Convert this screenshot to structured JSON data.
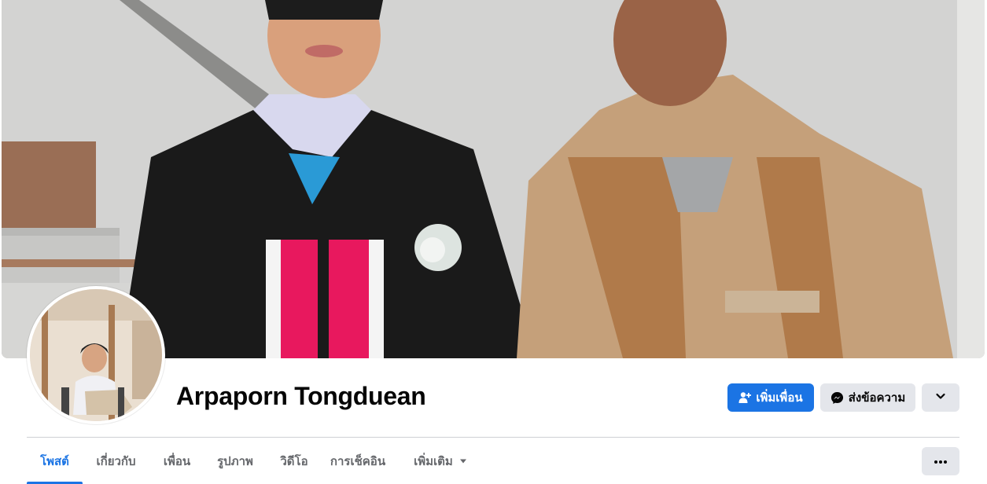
{
  "profile": {
    "name": "Arpaporn Tongduean",
    "cover_photo": "graduation-cover-photo",
    "avatar": "profile-avatar-photo"
  },
  "actions": {
    "add_friend_label": "เพิ่มเพื่อน",
    "add_friend_icon": "add-friend-icon",
    "message_label": "ส่งข้อความ",
    "message_icon": "messenger-icon",
    "more_icon": "chevron-down-icon"
  },
  "tabs": [
    {
      "label": "โพสต์",
      "active": true
    },
    {
      "label": "เกี่ยวกับ",
      "active": false
    },
    {
      "label": "เพื่อน",
      "active": false
    },
    {
      "label": "รูปภาพ",
      "active": false
    },
    {
      "label": "วิดีโอ",
      "active": false
    },
    {
      "label": "การเช็คอิน",
      "active": false
    },
    {
      "label": "เพิ่มเติม",
      "active": false
    }
  ],
  "tab_more_icon": "caret-down-icon",
  "options_icon": "more-options-icon",
  "colors": {
    "accent": "#1b74e4",
    "secondary_button": "#e4e6eb",
    "muted_text": "#65676b"
  }
}
